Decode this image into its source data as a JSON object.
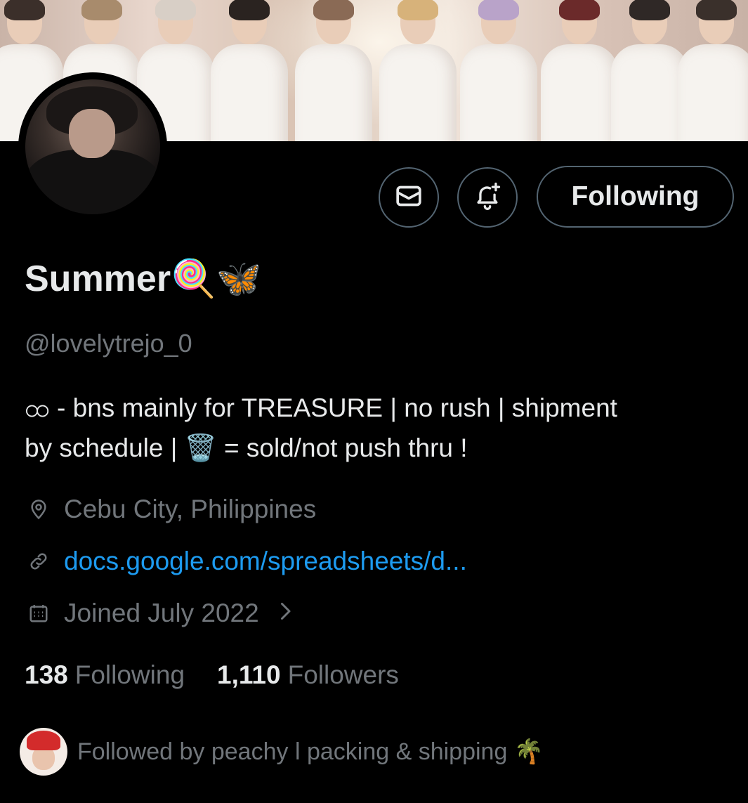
{
  "profile": {
    "display_name": "Summer🍭🦋",
    "handle": "@lovelytrejo_0",
    "bio_line1": "ထ - bns mainly for TREASURE  | no rush | shipment",
    "bio_line2": "by schedule | 🗑️ = sold/not push thru !",
    "location": "Cebu City, Philippines",
    "website": "docs.google.com/spreadsheets/d...",
    "joined": "Joined July 2022"
  },
  "actions": {
    "following_label": "Following"
  },
  "stats": {
    "following_count": "138",
    "following_label": "Following",
    "followers_count": "1,110",
    "followers_label": "Followers"
  },
  "followed_by": {
    "text": "Followed by peachy l packing & shipping 🌴"
  },
  "icons": {
    "message": "envelope-icon",
    "notifications": "bell-plus-icon",
    "location": "location-pin-icon",
    "link": "link-icon",
    "calendar": "calendar-icon",
    "chevron": "chevron-right-icon"
  },
  "colors": {
    "background": "#000000",
    "primary_text": "#e7e9ea",
    "secondary_text": "#71767b",
    "link": "#1d9bf0",
    "border": "#536471"
  }
}
